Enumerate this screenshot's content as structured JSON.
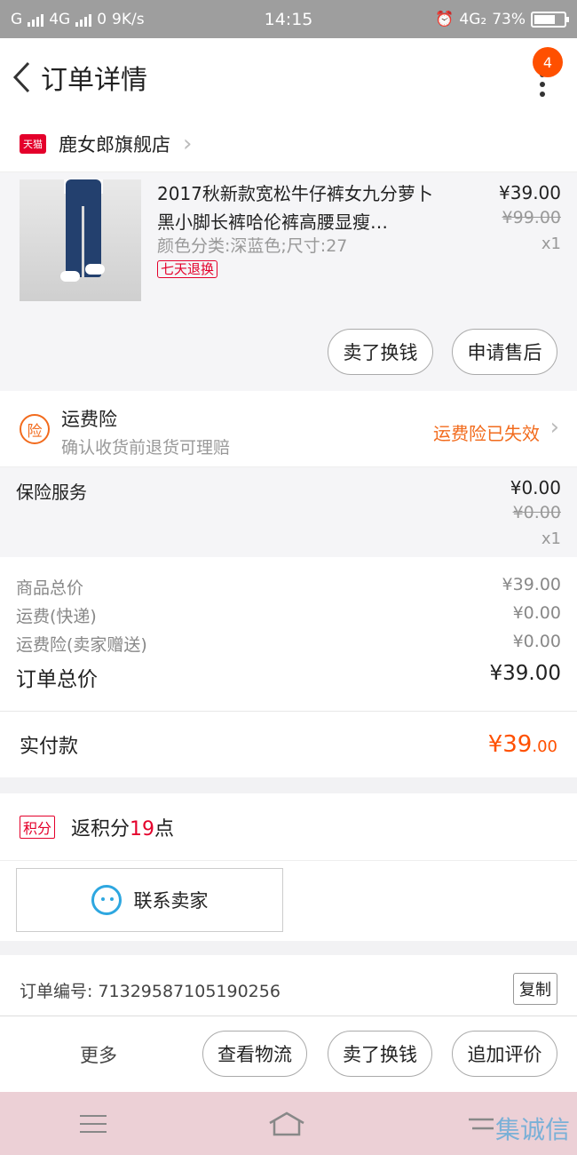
{
  "status_bar": {
    "left_text": "G",
    "network1": "4G",
    "network2": "0",
    "speed": "9K/s",
    "time": "14:15",
    "network3": "4G₂",
    "battery": "73%",
    "battery_level": 0.73
  },
  "navbar": {
    "title": "订单详情",
    "badge": "4"
  },
  "store": {
    "badge": "天猫",
    "name": "鹿女郎旗舰店"
  },
  "item": {
    "name": "2017秋新款宽松牛仔裤女九分萝卜黑小脚长裤哈伦裤高腰显瘦…",
    "sku": "颜色分类:深蓝色;尺寸:27",
    "tag": "七天退换",
    "price": "¥39.00",
    "orig_price": "¥99.00",
    "qty": "x1",
    "btn_sell": "卖了换钱",
    "btn_after": "申请售后"
  },
  "insurance": {
    "icon_text": "险",
    "title": "运费险",
    "desc": "确认收货前退货可理赔",
    "status": "运费险已失效"
  },
  "service": {
    "label": "保险服务",
    "price": "¥0.00",
    "orig_price": "¥0.00",
    "qty": "x1"
  },
  "summary": {
    "rows": [
      {
        "label": "商品总价",
        "value": "¥39.00"
      },
      {
        "label": "运费(快递)",
        "value": "¥0.00"
      },
      {
        "label": "运费险(卖家赠送)",
        "value": "¥0.00"
      }
    ],
    "total_label": "订单总价",
    "total_value": "¥39.00",
    "paid_label": "实付款",
    "paid_main": "¥39",
    "paid_cents": ".00"
  },
  "points": {
    "tag": "积分",
    "prefix": "返积分",
    "num": "19",
    "suffix": "点"
  },
  "contact": {
    "label": "联系卖家"
  },
  "order": {
    "number": "订单编号: 71329587105190256",
    "copy": "复制"
  },
  "bottom_bar": {
    "more": "更多",
    "logistics": "查看物流",
    "sell": "卖了换钱",
    "review": "追加评价"
  },
  "watermark": "集诚信",
  "colors": {
    "accent": "#ff5000",
    "tmall_red": "#e4002b",
    "insurance_orange": "#f26b1d",
    "contact_blue": "#2ea7e0"
  }
}
